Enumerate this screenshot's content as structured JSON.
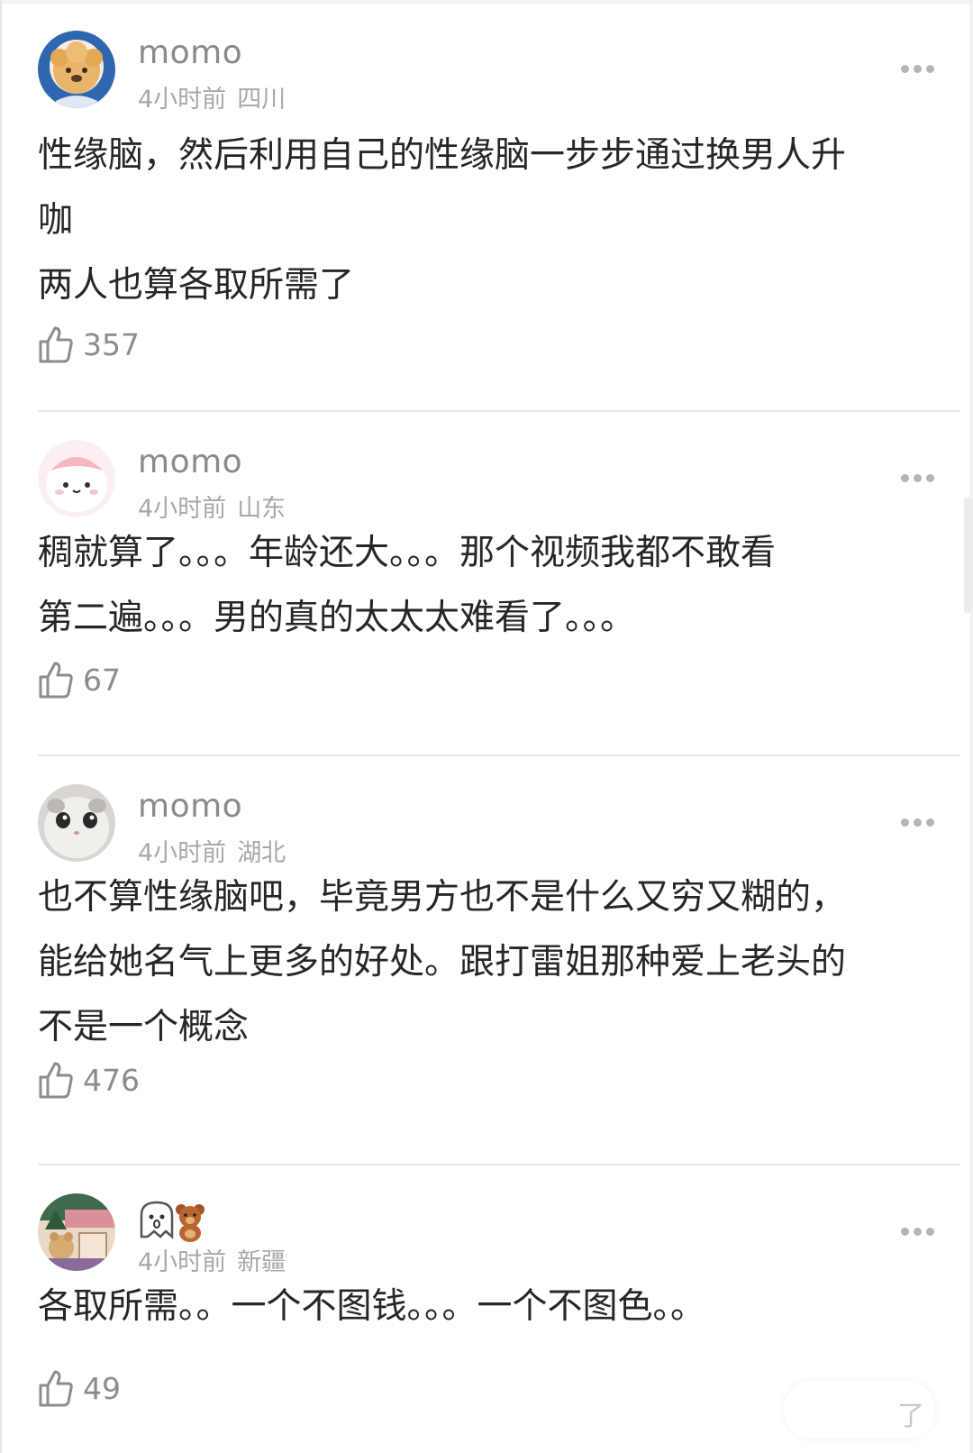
{
  "comments": [
    {
      "username": "momo",
      "time": "4小时前",
      "location": "四川",
      "text": "性缘脑，然后利用自己的性缘脑一步步通过换男人升\n咖\n两人也算各取所需了",
      "likes": "357",
      "avatar_icon": "teddy-dog-avatar"
    },
    {
      "username": "momo",
      "time": "4小时前",
      "location": "山东",
      "text": "稠就算了。。。年龄还大。。。那个视频我都不敢看\n第二遍。。。男的真的太太太难看了。。。",
      "likes": "67",
      "avatar_icon": "pink-bunny-avatar"
    },
    {
      "username": "momo",
      "time": "4小时前",
      "location": "湖北",
      "text": "也不算性缘脑吧，毕竟男方也不是什么又穷又糊的，\n能给她名气上更多的好处。跟打雷姐那种爱上老头的\n不是一个概念",
      "likes": "476",
      "avatar_icon": "white-cat-avatar"
    },
    {
      "username": "",
      "time": "4小时前",
      "location": "新疆",
      "text": "各取所需。。一个不图钱。。。一个不图色。。",
      "likes": "49",
      "avatar_icon": "bear-shop-avatar",
      "name_stickers": [
        "ghost-sticker",
        "teddy-bear-sticker"
      ]
    }
  ],
  "reply_hint": "了",
  "colors": {
    "username": "#8a8a8a",
    "meta": "#a8a8a8",
    "text": "#262626",
    "divider": "#e9e9e9"
  }
}
